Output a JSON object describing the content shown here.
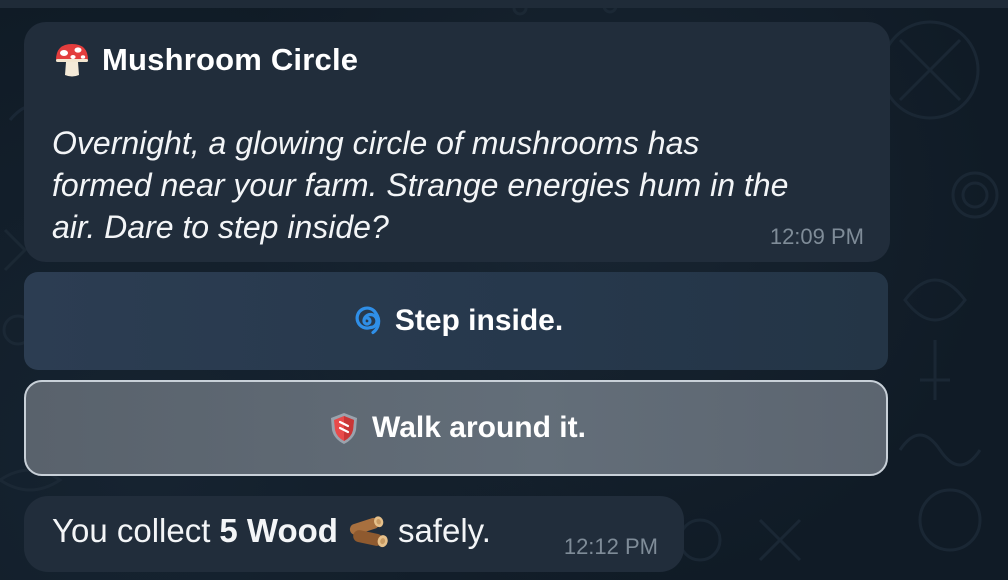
{
  "message": {
    "icon": "mushroom-icon",
    "title": "Mushroom Circle",
    "body_line1": "Overnight, a glowing circle of mushrooms has",
    "body_line2": "formed near your farm. Strange energies hum in the",
    "body_line3": "air. Dare to step inside?",
    "time": "12:09 PM"
  },
  "buttons": [
    {
      "icon": "cyclone-icon",
      "label": "Step inside."
    },
    {
      "icon": "shield-icon",
      "label": "Walk around it."
    }
  ],
  "reply": {
    "text_before": "You collect",
    "bold": "5 Wood",
    "icon": "wood-icon",
    "text_after": "safely.",
    "time": "12:12 PM"
  },
  "colors": {
    "bubble": "#212d3b",
    "background": "#101b26",
    "time": "#7f8c98",
    "button_step": "#2c3d52",
    "button_walk": "#636e79",
    "button_walk_border": "#c8d0d8"
  }
}
